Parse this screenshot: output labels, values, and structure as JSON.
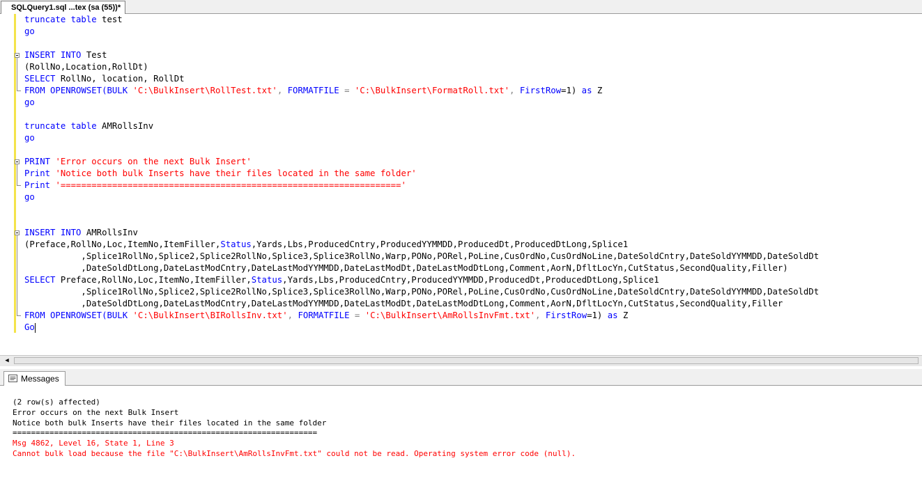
{
  "tab": {
    "title": "SQLQuery1.sql ...tex (sa (55))*"
  },
  "code": {
    "l01_a": "truncate table",
    "l01_b": " test",
    "l02": "go",
    "l04_a": "INSERT",
    "l04_b": "INTO",
    "l04_c": " Test",
    "l05": "(RollNo,Location,RollDt)",
    "l06_a": "SELECT",
    "l06_b": " RollNo, location, RollDt",
    "l07_a": "FROM",
    "l07_b": "OPENROWSET",
    "l07_c": "(BULK",
    "l07_d": "'C:\\BulkInsert\\RollTest.txt'",
    "l07_e": ",",
    "l07_f": "FORMATFILE",
    "l07_g": "=",
    "l07_h": "'C:\\BulkInsert\\FormatRoll.txt'",
    "l07_i": ",",
    "l07_j": "FirstRow",
    "l07_k": "=1)",
    "l07_l": "as",
    "l07_m": " Z",
    "l08": "go",
    "l10_a": "truncate table",
    "l10_b": " AMRollsInv",
    "l11": "go",
    "l13_a": "PRINT",
    "l13_b": "'Error occurs on the next Bulk Insert'",
    "l14_a": "Print",
    "l14_b": "'Notice both bulk Inserts have their files located in the same folder'",
    "l15_a": "Print",
    "l15_b": "'=================================================================='",
    "l16": "go",
    "l19_a": "INSERT",
    "l19_b": "INTO",
    "l19_c": " AMRollsInv",
    "l20_a": "(Preface,RollNo,Loc,ItemNo,ItemFiller,",
    "l20_b": "Status",
    "l20_c": ",Yards,Lbs,ProducedCntry,ProducedYYMMDD,ProducedDt,ProducedDtLong,Splice1",
    "l21": "           ,Splice1RollNo,Splice2,Splice2RollNo,Splice3,Splice3RollNo,Warp,PONo,PORel,PoLine,CusOrdNo,CusOrdNoLine,DateSoldCntry,DateSoldYYMMDD,DateSoldDt",
    "l22": "           ,DateSoldDtLong,DateLastModCntry,DateLastModYYMMDD,DateLastModDt,DateLastModDtLong,Comment,AorN,DfltLocYn,CutStatus,SecondQuality,Filler)",
    "l23_a": "SELECT",
    "l23_b": " Preface,RollNo,Loc,ItemNo,ItemFiller,",
    "l23_c": "Status",
    "l23_d": ",Yards,Lbs,ProducedCntry,ProducedYYMMDD,ProducedDt,ProducedDtLong,Splice1",
    "l24": "           ,Splice1RollNo,Splice2,Splice2RollNo,Splice3,Splice3RollNo,Warp,PONo,PORel,PoLine,CusOrdNo,CusOrdNoLine,DateSoldCntry,DateSoldYYMMDD,DateSoldDt",
    "l25": "           ,DateSoldDtLong,DateLastModCntry,DateLastModYYMMDD,DateLastModDt,DateLastModDtLong,Comment,AorN,DfltLocYn,CutStatus,SecondQuality,Filler",
    "l26_a": "FROM",
    "l26_b": "OPENROWSET",
    "l26_c": "(BULK",
    "l26_d": "'C:\\BulkInsert\\BIRollsInv.txt'",
    "l26_e": ",",
    "l26_f": "FORMATFILE",
    "l26_g": "=",
    "l26_h": "'C:\\BulkInsert\\AmRollsInvFmt.txt'",
    "l26_i": ",",
    "l26_j": "FirstRow",
    "l26_k": "=1)",
    "l26_l": "as",
    "l26_m": " Z",
    "l27": "Go"
  },
  "results": {
    "tab_label": "Messages",
    "lines": [
      "(2 row(s) affected)",
      "Error occurs on the next Bulk Insert",
      "Notice both bulk Inserts have their files located in the same folder",
      "==================================================================",
      "Msg 4862, Level 16, State 1, Line 3",
      "Cannot bulk load because the file \"C:\\BulkInsert\\AmRollsInvFmt.txt\" could not be read. Operating system error code (null)."
    ]
  },
  "colors": {
    "keyword": "#0000ff",
    "string": "#ff0000",
    "operator": "#808080",
    "function": "#ff00ff",
    "error": "#ff0000",
    "changed_margin": "#f4e34a"
  },
  "icons": [
    "messages-icon",
    "scroll-left-arrow-icon",
    "fold-minus-icon"
  ]
}
